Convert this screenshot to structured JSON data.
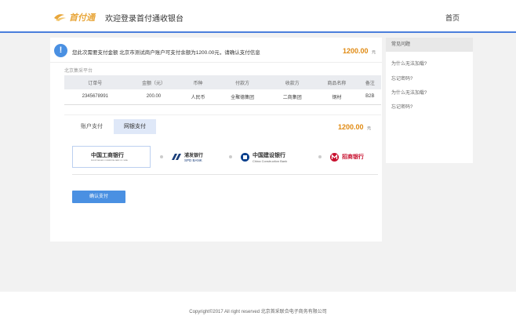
{
  "header": {
    "logo_text": "首付通",
    "welcome": "欢迎登录首付通收银台",
    "home_link": "首页"
  },
  "notice": {
    "icon": "info-icon",
    "text": "您此次需要支付金额 北京市测试商户账户可支付余额为1200.00元，请确认支付信息",
    "amount": "1200.00",
    "unit": "元"
  },
  "merchant": "北京集采平台",
  "order_table": {
    "headers": [
      "订单号",
      "金额（元）",
      "币种",
      "付款方",
      "收款方",
      "商品名称",
      "备注"
    ],
    "rows": [
      [
        "2345678991",
        "200.00",
        "人民币",
        "全聚德集团",
        "二商集团",
        "钢材",
        "B2B"
      ]
    ]
  },
  "payment": {
    "tabs": [
      "账户支付",
      "网银支付"
    ],
    "active_tab": "网银支付",
    "amount": "1200.00",
    "unit": "元",
    "banks": [
      {
        "name": "中国工商银行",
        "sub": "INDUSTRIAL AND COMMERCIAL BANK OF CHINA",
        "icon": "icbc-logo-icon",
        "selected": true,
        "color": "#c8102e"
      },
      {
        "name": "浦发银行",
        "sub": "SPD BANK",
        "icon": "spd-logo-icon",
        "selected": false,
        "color": "#1a3e7a"
      },
      {
        "name": "中国建设银行",
        "sub": "China Construction Bank",
        "icon": "ccb-logo-icon",
        "selected": false,
        "color": "#0a3f8c"
      },
      {
        "name": "招商银行",
        "sub": "",
        "icon": "cmb-logo-icon",
        "selected": false,
        "color": "#c8102e"
      }
    ],
    "confirm_label": "确认支付"
  },
  "faq": {
    "title": "常见问题",
    "items": [
      "为什么无法加载?",
      "忘记密码?",
      "为什么无法加载?",
      "忘记密码?"
    ]
  },
  "footer": {
    "copyright": "Copyright©2017 All right reserved 北京首采联合电子商务有限公司"
  },
  "colors": {
    "accent": "#4a90e2",
    "amount": "#e08a12",
    "header_border": "#4a7fdc"
  }
}
